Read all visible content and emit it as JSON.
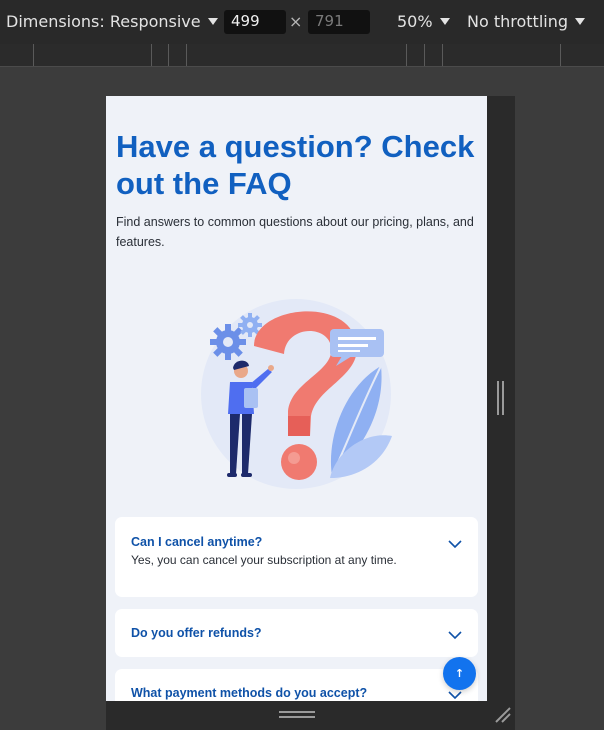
{
  "devtools": {
    "dimensions_label": "Dimensions: Responsive",
    "width_value": "499",
    "height_value": "791",
    "times_symbol": "×",
    "zoom_label": "50%",
    "throttling_label": "No throttling"
  },
  "page": {
    "title": "Have a question? Check out the FAQ",
    "subtitle": "Find answers to common questions about our pricing, plans, and features."
  },
  "faq": [
    {
      "question": "Can I cancel anytime?",
      "answer": "Yes, you can cancel your subscription at any time.",
      "expanded": true
    },
    {
      "question": "Do you offer refunds?",
      "answer": "",
      "expanded": false
    },
    {
      "question": "What payment methods do you accept?",
      "answer": "",
      "expanded": false
    }
  ],
  "scroll_top": {
    "icon": "arrow-up-icon",
    "symbol": "↑"
  },
  "colors": {
    "accent": "#1160c0",
    "fab": "#1273ee",
    "page_bg": "#eff2f8",
    "question_mark": "#f07a70"
  }
}
